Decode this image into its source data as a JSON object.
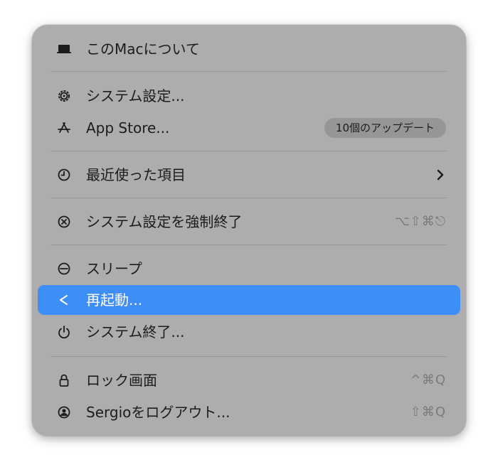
{
  "menu": {
    "about": {
      "label": "このMacについて",
      "icon": "laptop-icon"
    },
    "settings": {
      "label": "システム設定...",
      "icon": "gear-icon"
    },
    "app_store": {
      "label": "App Store...",
      "icon": "app-store-icon",
      "badge": "10個のアップデート"
    },
    "recent": {
      "label": "最近使った項目",
      "icon": "clock-icon"
    },
    "force_quit": {
      "label": "システム設定を強制終了",
      "icon": "x-circle-icon",
      "shortcut": "⌥⇧⌘⎋"
    },
    "sleep": {
      "label": "スリープ",
      "icon": "sleep-icon"
    },
    "restart": {
      "label": "再起動...",
      "icon": "restart-icon",
      "selected": true
    },
    "shutdown": {
      "label": "システム終了...",
      "icon": "power-icon"
    },
    "lock": {
      "label": "ロック画面",
      "icon": "lock-icon",
      "shortcut": "^⌘Q"
    },
    "logout": {
      "label": "Sergioをログアウト...",
      "icon": "user-icon",
      "shortcut": "⇧⌘Q"
    }
  },
  "colors": {
    "menu_background": "#adadad",
    "selection": "#3d8ef7",
    "text": "#1c1c1c",
    "shortcut_text": "#7a7a7a"
  }
}
